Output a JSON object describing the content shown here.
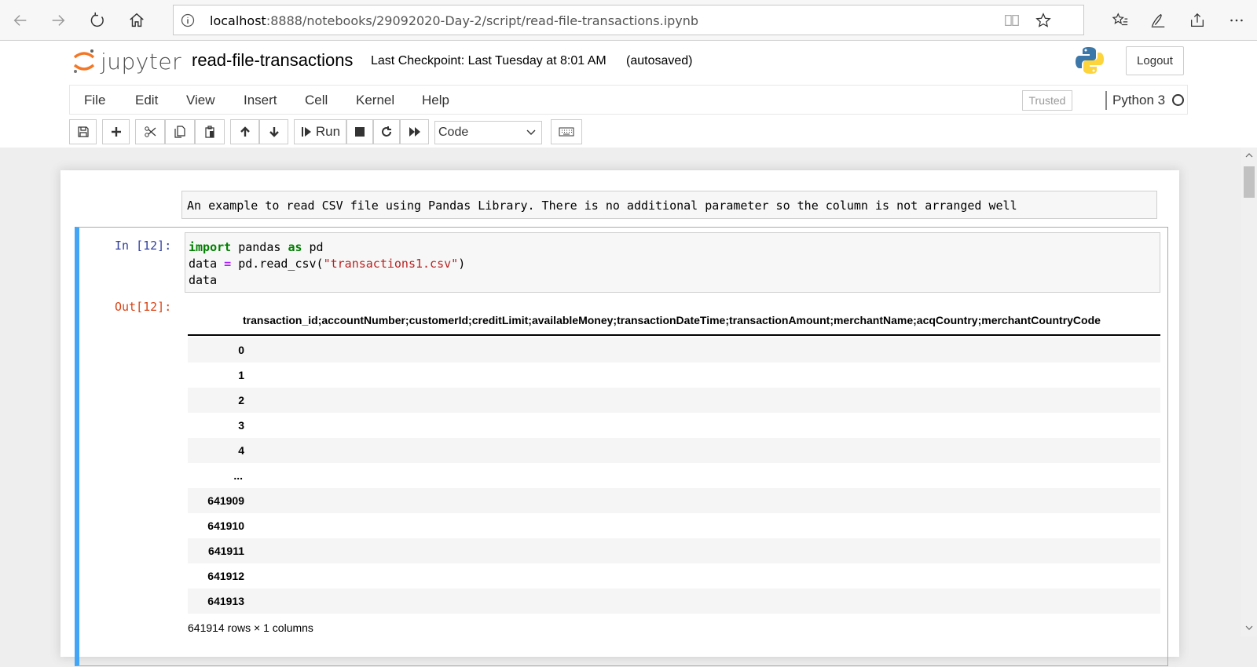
{
  "browser": {
    "url_host": "localhost",
    "url_path": ":8888/notebooks/29092020-Day-2/script/read-file-transactions.ipynb"
  },
  "header": {
    "logo_text": "jupyter",
    "notebook_title": "read-file-transactions",
    "checkpoint": "Last Checkpoint: Last Tuesday at 8:01 AM",
    "autosaved": "(autosaved)",
    "logout_label": "Logout"
  },
  "menu": {
    "items": [
      "File",
      "Edit",
      "View",
      "Insert",
      "Cell",
      "Kernel",
      "Help"
    ],
    "trusted_label": "Trusted",
    "kernel_name": "Python 3"
  },
  "toolbar": {
    "run_label": "Run",
    "cell_type": "Code"
  },
  "notebook": {
    "markdown_text": "An example to read CSV file using Pandas Library. There is no additional parameter so the column is not arranged well",
    "in_prompt": "In [12]:",
    "out_prompt": "Out[12]:",
    "code": {
      "line1_kw": "import",
      "line1_mid": " pandas ",
      "line1_kw2": "as",
      "line1_end": " pd",
      "line2_start": "data ",
      "line2_op": "=",
      "line2_mid": " pd.read_csv(",
      "line2_str": "\"transactions1.csv\"",
      "line2_end": ")",
      "line3": "data"
    },
    "dataframe": {
      "header": "transaction_id;accountNumber;customerId;creditLimit;availableMoney;transactionDateTime;transactionAmount;merchantName;acqCountry;merchantCountryCode",
      "rows": [
        "0",
        "1",
        "2",
        "3",
        "4",
        "...",
        "641909",
        "641910",
        "641911",
        "641912",
        "641913"
      ],
      "partial_footer": "641914 rows × 1 columns"
    }
  },
  "colors": {
    "cell_selected_border": "#42a5f5",
    "in_prompt": "#303f9f",
    "out_prompt": "#d84315"
  }
}
